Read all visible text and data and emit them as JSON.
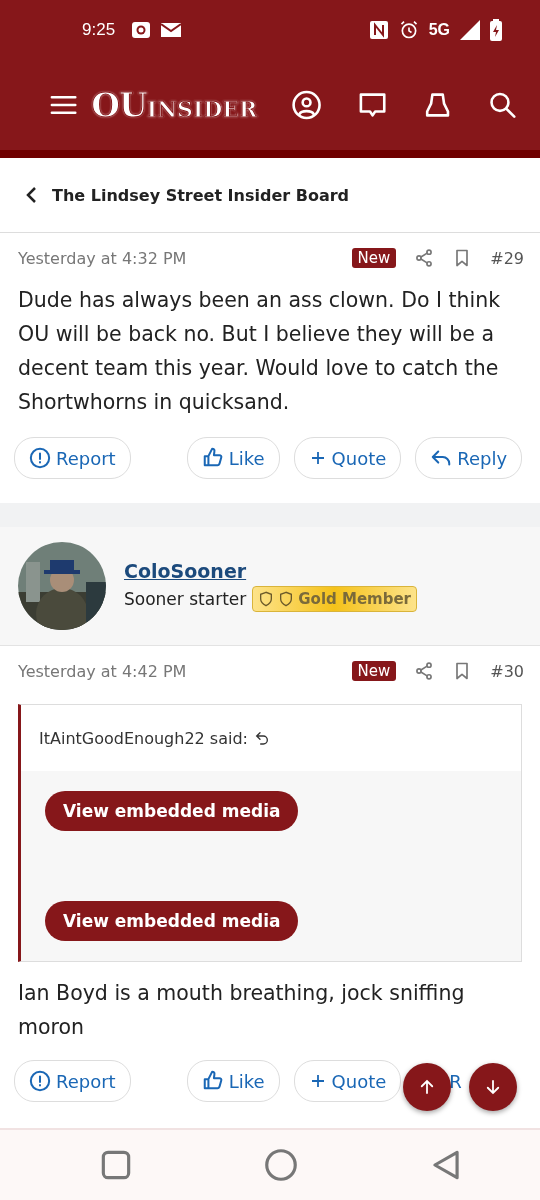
{
  "status_bar": {
    "time": "9:25",
    "network": "5G"
  },
  "header": {
    "logo_main": "OU",
    "logo_rest": "INSIDER"
  },
  "breadcrumb": {
    "label": "The Lindsey Street Insider Board"
  },
  "posts": [
    {
      "time": "Yesterday at 4:32 PM",
      "badge": "New",
      "number": "#29",
      "body": "Dude has always been an ass clown. Do I think OU will be back no. But I believe they will be a decent team this year. Would love to catch the Shortwhorns in quicksand.",
      "actions": {
        "report": "Report",
        "like": "Like",
        "quote": "Quote",
        "reply": "Reply"
      }
    },
    {
      "time": "Yesterday at 4:42 PM",
      "badge": "New",
      "number": "#30",
      "author": {
        "name": "ColoSooner",
        "title": "Sooner starter",
        "banner": "Gold Member"
      },
      "quote": {
        "attribution": "ItAintGoodEnough22 said:",
        "media": [
          "View embedded media",
          "View embedded media"
        ]
      },
      "body": "Ian Boyd is a mouth breathing, jock sniffing moron",
      "actions": {
        "report": "Report",
        "like": "Like",
        "quote": "Quote",
        "reply": "R"
      }
    }
  ]
}
